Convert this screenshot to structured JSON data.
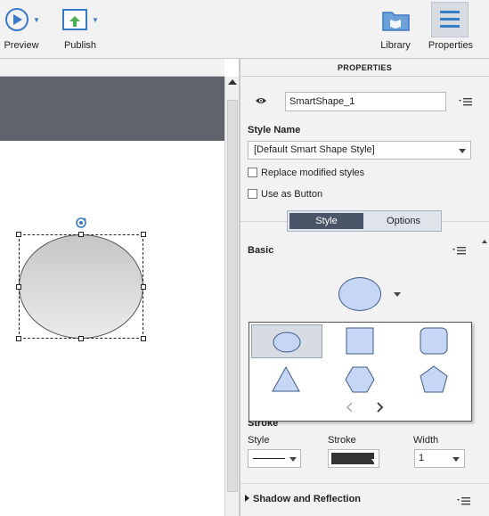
{
  "toolbar": {
    "preview_label": "Preview",
    "publish_label": "Publish",
    "library_label": "Library",
    "properties_label": "Properties"
  },
  "panel": {
    "header": "PROPERTIES",
    "name_value": "SmartShape_1",
    "style_name_label": "Style Name",
    "style_name_value": "[Default Smart Shape Style]",
    "replace_modified_label": "Replace modified styles",
    "use_as_button_label": "Use as Button",
    "tabs": {
      "style": "Style",
      "options": "Options"
    },
    "basic_label": "Basic",
    "stroke_label": "Stroke",
    "fields": {
      "style_label": "Style",
      "stroke_label": "Stroke",
      "width_label": "Width",
      "width_value": "1"
    },
    "shadow_label": "Shadow and Reflection"
  },
  "shape_picker": {
    "shapes": [
      "ellipse",
      "rectangle",
      "rounded-rectangle",
      "triangle",
      "hexagon",
      "pentagon"
    ],
    "selected": "ellipse"
  },
  "colors": {
    "accent": "#3a78c8",
    "stage_dark": "#5f636b",
    "shape_fill": "#c5d7f5",
    "shape_stroke": "#3d5a8a",
    "tab_active": "#4a5568"
  }
}
